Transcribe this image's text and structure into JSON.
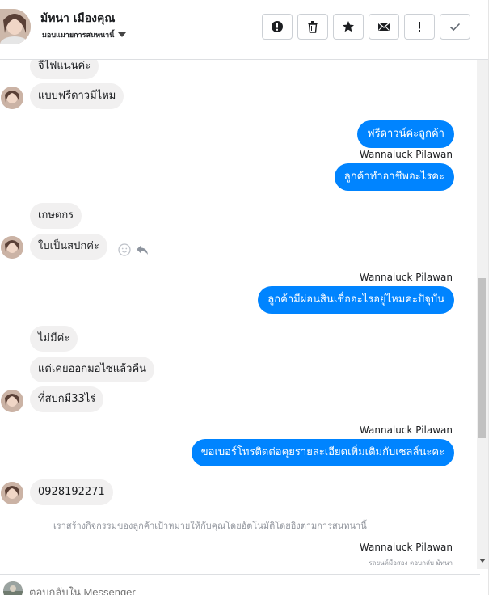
{
  "header": {
    "contact_name": "ม้ทนา เมืองคุณ",
    "assign_label": "มอบแมายการสนทนานี้",
    "actions": [
      {
        "name": "report-icon",
        "title": "!"
      },
      {
        "name": "trash-icon",
        "title": ""
      },
      {
        "name": "star-icon",
        "title": ""
      },
      {
        "name": "mail-icon",
        "title": ""
      },
      {
        "name": "exclamation-icon",
        "title": "!"
      },
      {
        "name": "check-icon",
        "title": ""
      }
    ]
  },
  "conversation": {
    "messages": [
      {
        "dir": "in",
        "text": "จีไฟแนนค่ะ"
      },
      {
        "dir": "in",
        "text": "แบบฟรีดาวมีไหม"
      },
      {
        "dir": "out",
        "text": "ฟรีดาวน์ค่ะลูกค้า"
      },
      {
        "dir": "out",
        "sender": "Wannaluck Pilawan",
        "text": "ลูกค้าทำอาชีพอะไรคะ"
      },
      {
        "dir": "in",
        "text": "เกษตกร"
      },
      {
        "dir": "in",
        "text": "ใบเป็นสปกค่ะ"
      },
      {
        "dir": "out",
        "sender": "Wannaluck Pilawan",
        "text": "ลูกค้ามีผ่อนสินเชื่ออะไรอยู่ไหมคะปัจุบัน"
      },
      {
        "dir": "in",
        "text": "ไม่มีค่ะ"
      },
      {
        "dir": "in",
        "text": "แต่เคยออกมอไซแล้วคืน"
      },
      {
        "dir": "in",
        "text": "ที่สปกมี33ไร่"
      },
      {
        "dir": "out",
        "sender": "Wannaluck Pilawan",
        "text": "ขอเบอร์โทรติดต่อคุยรายละเอียดเพิ่มเติมกับเซลล์นะคะ"
      },
      {
        "dir": "in",
        "text": "0928192271"
      }
    ],
    "system_note": "เราสร้างกิจกรรมของลูกค้าเป้าหมายให้กับคุณโดยอัตโนมัติโดยอิงตามการสนทนานี้",
    "last_sender": "Wannaluck Pilawan",
    "seen_text": "รถยนต์มือสอง ตอบกลับ ม้ทนา"
  },
  "composer": {
    "placeholder": "ตอบกลับใน Messenger"
  },
  "colors": {
    "outgoing_bubble": "#0084ff",
    "incoming_bubble": "#f1f0f0"
  }
}
